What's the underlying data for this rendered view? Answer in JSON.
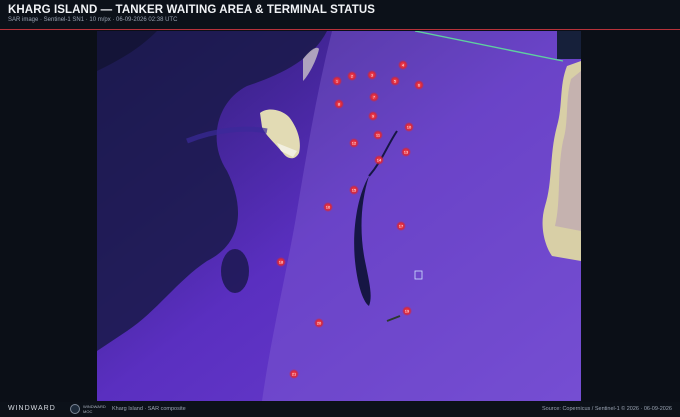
{
  "header": {
    "title": "KHARG ISLAND — TANKER WAITING AREA & TERMINAL STATUS",
    "subtitle": "SAR image · Sentinel-1 SN1 · 10 m/px · 06-09-2026 02:38 UTC"
  },
  "map": {
    "colors": {
      "water": "#3b1f8a",
      "deep_water": "#1a1a4a",
      "coast": "#d8cfa6",
      "tanker": "#e83a4a"
    },
    "tanker_labels": [
      "1",
      "2",
      "3",
      "4",
      "5",
      "6",
      "7",
      "8",
      "9",
      "10",
      "11",
      "12",
      "13",
      "14",
      "15",
      "16",
      "17",
      "18",
      "19",
      "20",
      "21"
    ]
  },
  "footer": {
    "brand": "WINDWARD",
    "partner_line1": "WINDWARD",
    "partner_line2": "MOC",
    "caption": "Kharg Island · SAR composite",
    "source": "Source: Copernicus / Sentinel-1 © 2026 · 06-09-2026"
  }
}
